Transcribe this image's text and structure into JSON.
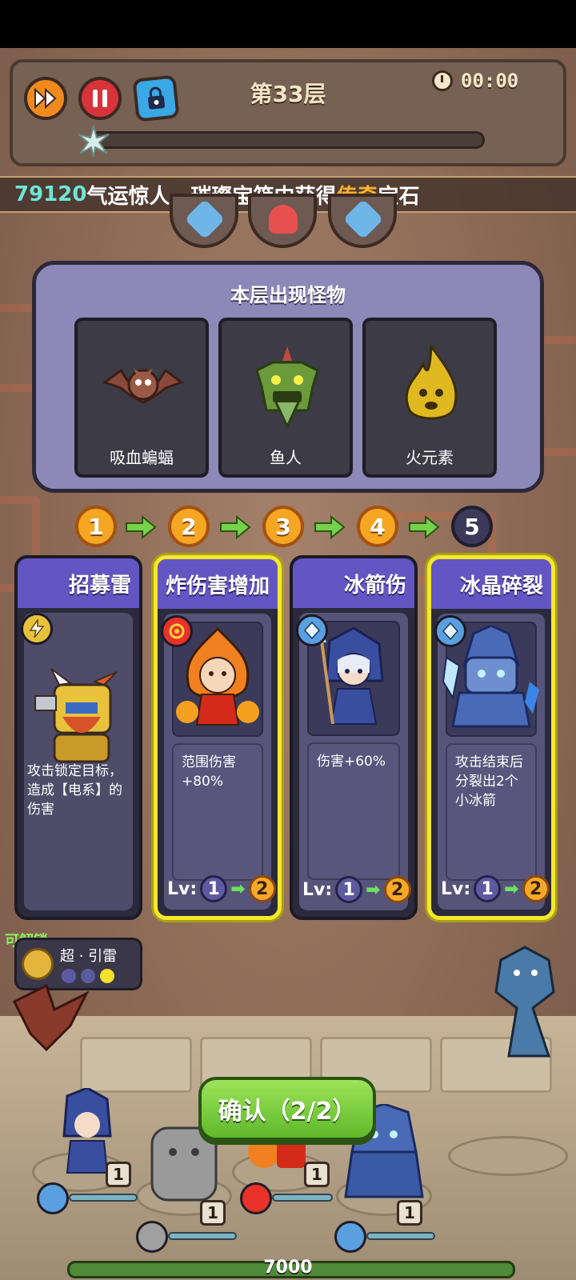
{
  "hud": {
    "level": "第33层",
    "timer": "00:00",
    "progress_fraction": 0.0
  },
  "ticker": {
    "id_text": "79120",
    "message_before": "气运惊人，璀璨宝箱中获得",
    "message_highlight": "传奇",
    "message_after": "宝石"
  },
  "monsters": {
    "title": "本层出现怪物",
    "items": [
      {
        "name": "吸血蝙蝠",
        "icon": "bat-icon"
      },
      {
        "name": "鱼人",
        "icon": "fishman-icon"
      },
      {
        "name": "火元素",
        "icon": "fire-elemental-icon"
      }
    ]
  },
  "steps": {
    "labels": [
      "1",
      "2",
      "3",
      "4",
      "5"
    ],
    "current": 5
  },
  "cards": [
    {
      "title": "招募雷",
      "desc": "攻击锁定目标，造成【电系】的伤害",
      "element": "lightning-icon"
    },
    {
      "title": "炸伤害增加",
      "desc": "范围伤害+80%",
      "lv_from": "1",
      "lv_to": "2",
      "lv_prefix": "Lv:",
      "selected": true,
      "element": "fire-ring-icon"
    },
    {
      "title": "冰箭伤",
      "desc": "伤害+60%",
      "lv_from": "1",
      "lv_to": "2",
      "lv_prefix": "Lv:",
      "selected": false,
      "element": "ice-crystal-icon"
    },
    {
      "title": "冰晶碎裂",
      "desc": "攻击结束后分裂出2个小冰箭",
      "lv_from": "1",
      "lv_to": "2",
      "lv_prefix": "Lv:",
      "selected": true,
      "element": "ice-crystal-icon"
    }
  ],
  "unlock": {
    "label": "可解锁",
    "name": "超 · 引雷",
    "dots_on": 1,
    "dots_total": 3
  },
  "confirm": {
    "label": "确认（2/2）"
  },
  "units": [
    {
      "lv": "1"
    },
    {
      "lv": "1"
    },
    {
      "lv": "1"
    },
    {
      "lv": "1"
    }
  ],
  "base_hp": "7000",
  "colors": {
    "accent_gold": "#f5a623",
    "select_yellow": "#f4e82a",
    "confirm_green": "#6fc832",
    "card_header": "#6356c2"
  }
}
